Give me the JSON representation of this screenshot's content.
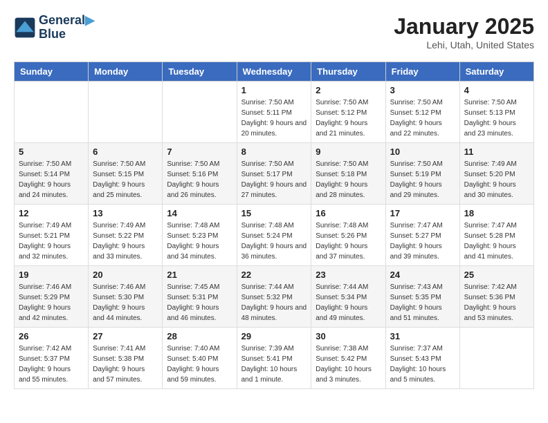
{
  "logo": {
    "line1": "General",
    "line2": "Blue"
  },
  "title": "January 2025",
  "subtitle": "Lehi, Utah, United States",
  "weekdays": [
    "Sunday",
    "Monday",
    "Tuesday",
    "Wednesday",
    "Thursday",
    "Friday",
    "Saturday"
  ],
  "weeks": [
    [
      {
        "day": "",
        "sunrise": "",
        "sunset": "",
        "daylight": ""
      },
      {
        "day": "",
        "sunrise": "",
        "sunset": "",
        "daylight": ""
      },
      {
        "day": "",
        "sunrise": "",
        "sunset": "",
        "daylight": ""
      },
      {
        "day": "1",
        "sunrise": "Sunrise: 7:50 AM",
        "sunset": "Sunset: 5:11 PM",
        "daylight": "Daylight: 9 hours and 20 minutes."
      },
      {
        "day": "2",
        "sunrise": "Sunrise: 7:50 AM",
        "sunset": "Sunset: 5:12 PM",
        "daylight": "Daylight: 9 hours and 21 minutes."
      },
      {
        "day": "3",
        "sunrise": "Sunrise: 7:50 AM",
        "sunset": "Sunset: 5:12 PM",
        "daylight": "Daylight: 9 hours and 22 minutes."
      },
      {
        "day": "4",
        "sunrise": "Sunrise: 7:50 AM",
        "sunset": "Sunset: 5:13 PM",
        "daylight": "Daylight: 9 hours and 23 minutes."
      }
    ],
    [
      {
        "day": "5",
        "sunrise": "Sunrise: 7:50 AM",
        "sunset": "Sunset: 5:14 PM",
        "daylight": "Daylight: 9 hours and 24 minutes."
      },
      {
        "day": "6",
        "sunrise": "Sunrise: 7:50 AM",
        "sunset": "Sunset: 5:15 PM",
        "daylight": "Daylight: 9 hours and 25 minutes."
      },
      {
        "day": "7",
        "sunrise": "Sunrise: 7:50 AM",
        "sunset": "Sunset: 5:16 PM",
        "daylight": "Daylight: 9 hours and 26 minutes."
      },
      {
        "day": "8",
        "sunrise": "Sunrise: 7:50 AM",
        "sunset": "Sunset: 5:17 PM",
        "daylight": "Daylight: 9 hours and 27 minutes."
      },
      {
        "day": "9",
        "sunrise": "Sunrise: 7:50 AM",
        "sunset": "Sunset: 5:18 PM",
        "daylight": "Daylight: 9 hours and 28 minutes."
      },
      {
        "day": "10",
        "sunrise": "Sunrise: 7:50 AM",
        "sunset": "Sunset: 5:19 PM",
        "daylight": "Daylight: 9 hours and 29 minutes."
      },
      {
        "day": "11",
        "sunrise": "Sunrise: 7:49 AM",
        "sunset": "Sunset: 5:20 PM",
        "daylight": "Daylight: 9 hours and 30 minutes."
      }
    ],
    [
      {
        "day": "12",
        "sunrise": "Sunrise: 7:49 AM",
        "sunset": "Sunset: 5:21 PM",
        "daylight": "Daylight: 9 hours and 32 minutes."
      },
      {
        "day": "13",
        "sunrise": "Sunrise: 7:49 AM",
        "sunset": "Sunset: 5:22 PM",
        "daylight": "Daylight: 9 hours and 33 minutes."
      },
      {
        "day": "14",
        "sunrise": "Sunrise: 7:48 AM",
        "sunset": "Sunset: 5:23 PM",
        "daylight": "Daylight: 9 hours and 34 minutes."
      },
      {
        "day": "15",
        "sunrise": "Sunrise: 7:48 AM",
        "sunset": "Sunset: 5:24 PM",
        "daylight": "Daylight: 9 hours and 36 minutes."
      },
      {
        "day": "16",
        "sunrise": "Sunrise: 7:48 AM",
        "sunset": "Sunset: 5:26 PM",
        "daylight": "Daylight: 9 hours and 37 minutes."
      },
      {
        "day": "17",
        "sunrise": "Sunrise: 7:47 AM",
        "sunset": "Sunset: 5:27 PM",
        "daylight": "Daylight: 9 hours and 39 minutes."
      },
      {
        "day": "18",
        "sunrise": "Sunrise: 7:47 AM",
        "sunset": "Sunset: 5:28 PM",
        "daylight": "Daylight: 9 hours and 41 minutes."
      }
    ],
    [
      {
        "day": "19",
        "sunrise": "Sunrise: 7:46 AM",
        "sunset": "Sunset: 5:29 PM",
        "daylight": "Daylight: 9 hours and 42 minutes."
      },
      {
        "day": "20",
        "sunrise": "Sunrise: 7:46 AM",
        "sunset": "Sunset: 5:30 PM",
        "daylight": "Daylight: 9 hours and 44 minutes."
      },
      {
        "day": "21",
        "sunrise": "Sunrise: 7:45 AM",
        "sunset": "Sunset: 5:31 PM",
        "daylight": "Daylight: 9 hours and 46 minutes."
      },
      {
        "day": "22",
        "sunrise": "Sunrise: 7:44 AM",
        "sunset": "Sunset: 5:32 PM",
        "daylight": "Daylight: 9 hours and 48 minutes."
      },
      {
        "day": "23",
        "sunrise": "Sunrise: 7:44 AM",
        "sunset": "Sunset: 5:34 PM",
        "daylight": "Daylight: 9 hours and 49 minutes."
      },
      {
        "day": "24",
        "sunrise": "Sunrise: 7:43 AM",
        "sunset": "Sunset: 5:35 PM",
        "daylight": "Daylight: 9 hours and 51 minutes."
      },
      {
        "day": "25",
        "sunrise": "Sunrise: 7:42 AM",
        "sunset": "Sunset: 5:36 PM",
        "daylight": "Daylight: 9 hours and 53 minutes."
      }
    ],
    [
      {
        "day": "26",
        "sunrise": "Sunrise: 7:42 AM",
        "sunset": "Sunset: 5:37 PM",
        "daylight": "Daylight: 9 hours and 55 minutes."
      },
      {
        "day": "27",
        "sunrise": "Sunrise: 7:41 AM",
        "sunset": "Sunset: 5:38 PM",
        "daylight": "Daylight: 9 hours and 57 minutes."
      },
      {
        "day": "28",
        "sunrise": "Sunrise: 7:40 AM",
        "sunset": "Sunset: 5:40 PM",
        "daylight": "Daylight: 9 hours and 59 minutes."
      },
      {
        "day": "29",
        "sunrise": "Sunrise: 7:39 AM",
        "sunset": "Sunset: 5:41 PM",
        "daylight": "Daylight: 10 hours and 1 minute."
      },
      {
        "day": "30",
        "sunrise": "Sunrise: 7:38 AM",
        "sunset": "Sunset: 5:42 PM",
        "daylight": "Daylight: 10 hours and 3 minutes."
      },
      {
        "day": "31",
        "sunrise": "Sunrise: 7:37 AM",
        "sunset": "Sunset: 5:43 PM",
        "daylight": "Daylight: 10 hours and 5 minutes."
      },
      {
        "day": "",
        "sunrise": "",
        "sunset": "",
        "daylight": ""
      }
    ]
  ]
}
